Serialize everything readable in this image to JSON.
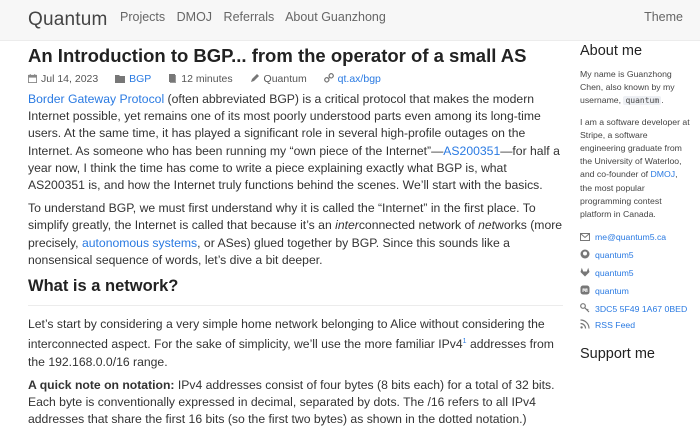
{
  "nav": {
    "brand": "Quantum",
    "links": [
      "Projects",
      "DMOJ",
      "Referrals",
      "About Guanzhong"
    ],
    "theme": "Theme"
  },
  "article": {
    "title": "An Introduction to BGP... from the operator of a small AS",
    "meta": {
      "date": "Jul 14, 2023",
      "tag": "BGP",
      "read_time": "12 minutes",
      "author": "Quantum",
      "short_link": "qt.ax/bgp"
    },
    "p1": {
      "link1": "Border Gateway Protocol",
      "t1": " (often abbreviated BGP) is a critical protocol that makes the modern Internet possible, yet remains one of its most poorly understood parts even among its long-time users. At the same time, it has played a significant role in several high-profile outages on the Internet. As someone who has been running my “own piece of the Internet”—",
      "link2": "AS200351",
      "t2": "—for half a year now, I think the time has come to write a piece explaining exactly what BGP is, what AS200351 is, and how the Internet truly functions behind the scenes. We’ll start with the basics."
    },
    "p2": {
      "t1": "To understand BGP, we must first understand why it is called the “Internet” in the first place. To simplify greatly, the Internet is called that because it’s an ",
      "em1": "inter",
      "t2": "connected network of ",
      "em2": "net",
      "t3": "works (more precisely, ",
      "link": "autonomous systems",
      "t4": ", or ASes) glued together by BGP. Since this sounds like a nonsensical sequence of words, let’s dive a bit deeper."
    },
    "h2": "What is a network?",
    "p3": {
      "t1": "Let’s start by considering a very simple home network belonging to Alice without considering the interconnected aspect. For the sake of simplicity, we’ll use the more familiar IPv4",
      "footnote": "1",
      "t2": " addresses from the 192.168.0.0/16 range."
    },
    "p4": {
      "bold": "A quick note on notation:",
      "t1": " IPv4 addresses consist of four bytes (8 bits each) for a total of 32 bits. Each byte is conventionally expressed in decimal, separated by dots. The /16 refers to all IPv4 addresses that share the first 16 bits (so the first two bytes) as shown in the dotted notation.)"
    }
  },
  "sidebar": {
    "about_heading": "About me",
    "bio1": {
      "t1": "My name is Guanzhong Chen, also known by my username, ",
      "code": "quantum",
      "t2": "."
    },
    "bio2": {
      "t1": "I am a software developer at Stripe, a software engineering graduate from the University of Waterloo, and co-founder of ",
      "link": "DMOJ",
      "t2": ", the most popular programming contest platform in Canada."
    },
    "contacts": [
      {
        "icon": "mail-icon",
        "text": "me@quantum5.ca"
      },
      {
        "icon": "github-icon",
        "text": "quantum5"
      },
      {
        "icon": "gitlab-icon",
        "text": "quantum5"
      },
      {
        "icon": "mastodon-icon",
        "text": "quantum"
      },
      {
        "icon": "key-icon",
        "text": "3DC5 5F49 1A67 0BED"
      },
      {
        "icon": "rss-icon",
        "text": "RSS Feed"
      }
    ],
    "support_heading": "Support me"
  }
}
